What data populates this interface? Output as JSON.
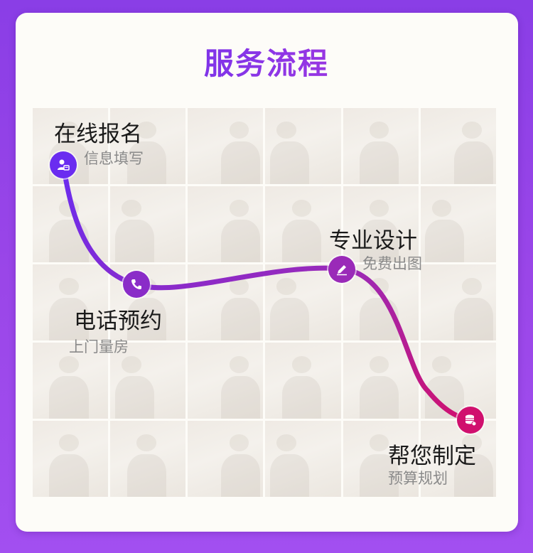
{
  "title": "服务流程",
  "steps": [
    {
      "title": "在线报名",
      "subtitle": "信息填写",
      "icon": "user-form-icon"
    },
    {
      "title": "电话预约",
      "subtitle": "上门量房",
      "icon": "phone-icon"
    },
    {
      "title": "专业设计",
      "subtitle": "免费出图",
      "icon": "pencil-icon"
    },
    {
      "title": "帮您制定",
      "subtitle": "预算规划",
      "icon": "coins-icon"
    }
  ],
  "colors": {
    "background": "#9a46e8",
    "card": "#fdfcf8",
    "path_start": "#6a2cf0",
    "path_end": "#d0106e"
  }
}
